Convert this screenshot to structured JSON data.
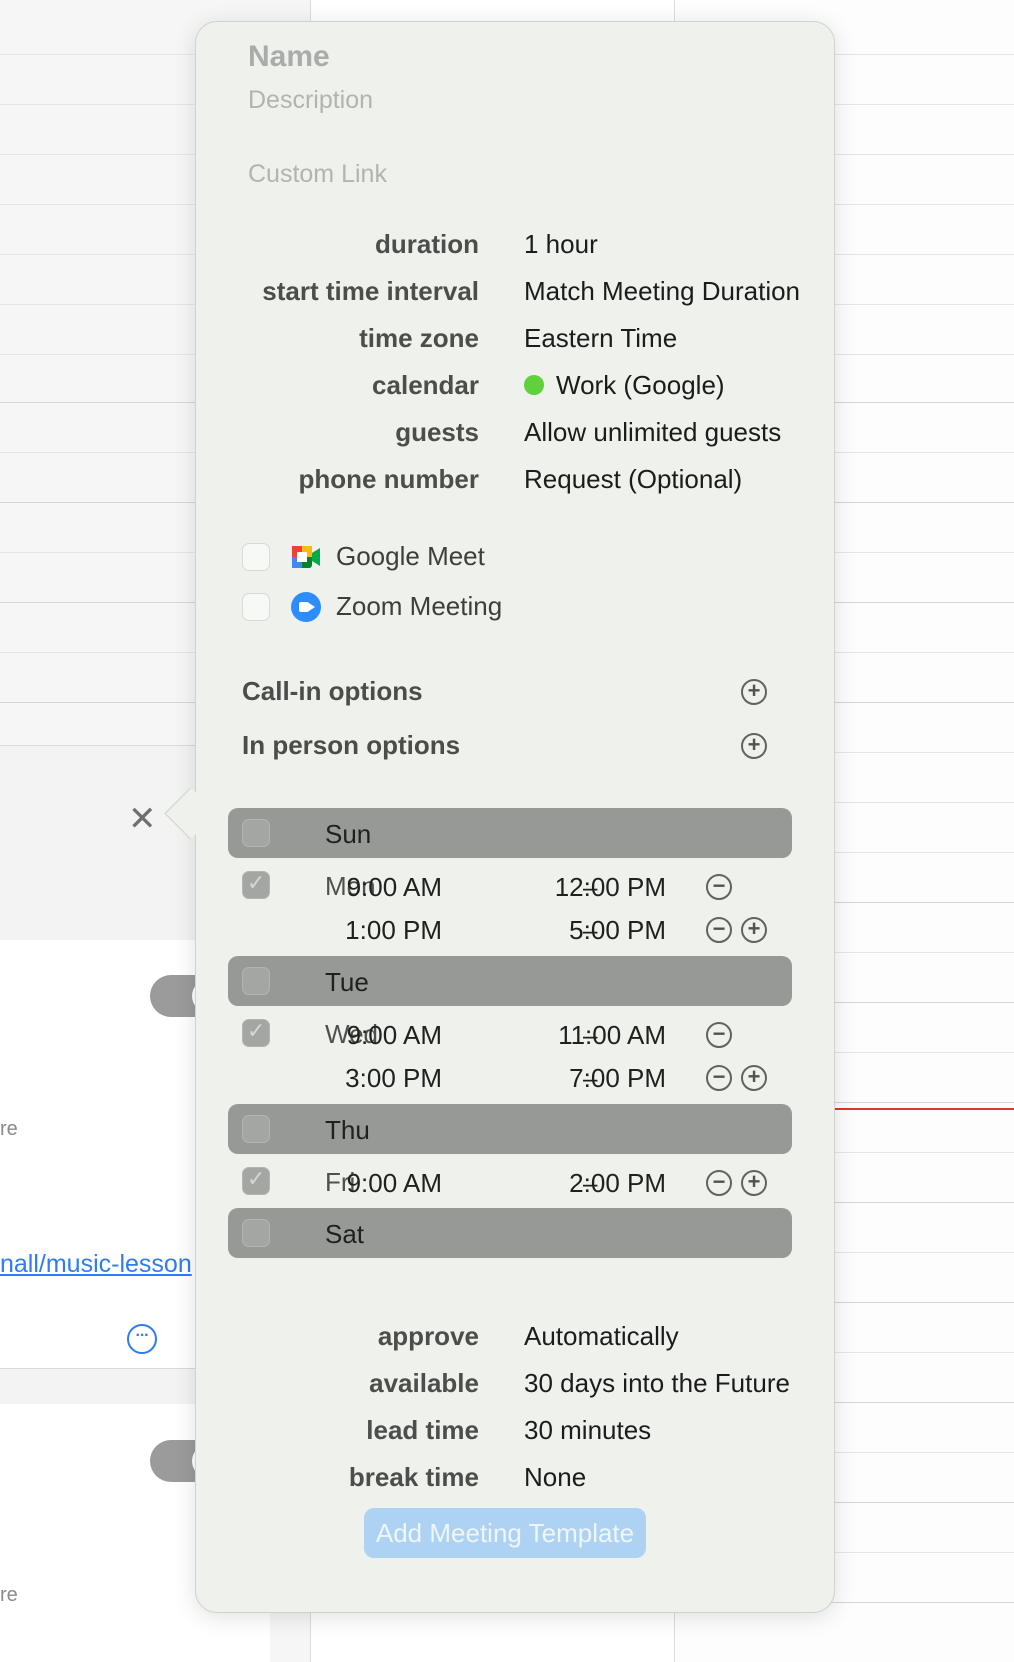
{
  "form": {
    "name_placeholder": "Name",
    "description_placeholder": "Description",
    "custom_link_placeholder": "Custom Link"
  },
  "properties": [
    {
      "label": "duration",
      "value": "1 hour"
    },
    {
      "label": "start time interval",
      "value": "Match Meeting Duration"
    },
    {
      "label": "time zone",
      "value": "Eastern Time"
    },
    {
      "label": "calendar",
      "value": "Work (Google)"
    },
    {
      "label": "guests",
      "value": "Allow unlimited guests"
    },
    {
      "label": "phone number",
      "value": "Request (Optional)"
    }
  ],
  "calendar_color": "#5fd13a",
  "conferencing": [
    {
      "label": "Google Meet",
      "checked": false,
      "icon": "google-meet-icon"
    },
    {
      "label": "Zoom Meeting",
      "checked": false,
      "icon": "zoom-icon"
    }
  ],
  "options": [
    {
      "label": "Call-in options",
      "icon": "plus-circle-icon"
    },
    {
      "label": "In person options",
      "icon": "plus-circle-icon"
    }
  ],
  "days": [
    {
      "name": "Sun",
      "enabled": false
    },
    {
      "name": "Mon",
      "enabled": true,
      "slots": [
        {
          "start": "9:00 AM",
          "dash": "–",
          "end": "12:00 PM"
        },
        {
          "start": "1:00 PM",
          "dash": "–",
          "end": "5:00 PM"
        }
      ]
    },
    {
      "name": "Tue",
      "enabled": false
    },
    {
      "name": "Wed",
      "enabled": true,
      "slots": [
        {
          "start": "9:00 AM",
          "dash": "–",
          "end": "11:00 AM"
        },
        {
          "start": "3:00 PM",
          "dash": "–",
          "end": "7:00 PM"
        }
      ]
    },
    {
      "name": "Thu",
      "enabled": false
    },
    {
      "name": "Fri",
      "enabled": true,
      "slots": [
        {
          "start": "9:00 AM",
          "dash": "–",
          "end": "2:00 PM"
        }
      ]
    },
    {
      "name": "Sat",
      "enabled": false
    }
  ],
  "settings": [
    {
      "label": "approve",
      "value": "Automatically"
    },
    {
      "label": "available",
      "value": "30 days into the Future"
    },
    {
      "label": "lead time",
      "value": "30 minutes"
    },
    {
      "label": "break time",
      "value": "None"
    }
  ],
  "add_button_label": "Add Meeting Template",
  "background": {
    "link_text": "nall/music-lesson",
    "tiny_text_1": "re",
    "tiny_text_2": "re",
    "accent_color": "#2f7bf5",
    "now_line_color": "#e0362c"
  }
}
